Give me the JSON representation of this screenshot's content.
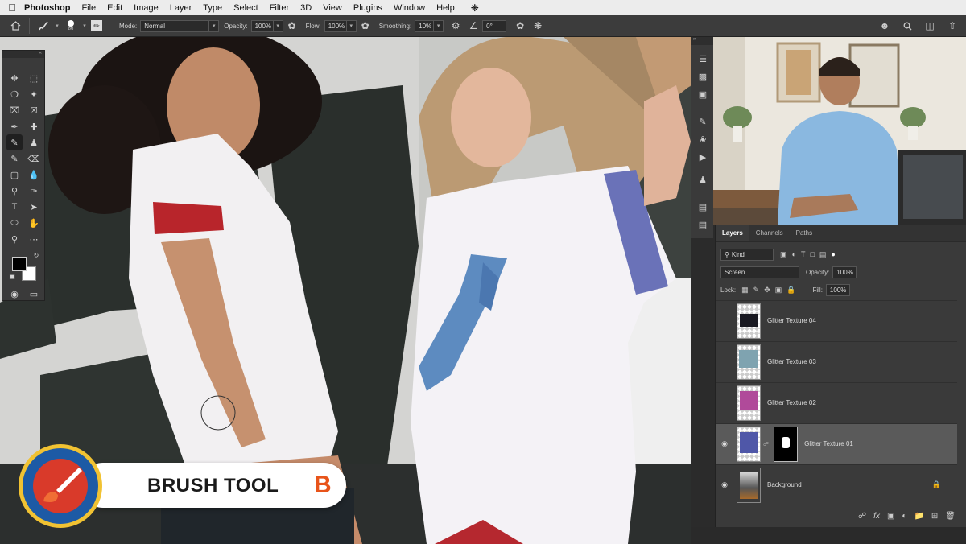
{
  "menubar": {
    "apple_icon": "apple-logo",
    "app_name": "Photoshop",
    "items": [
      "File",
      "Edit",
      "Image",
      "Layer",
      "Type",
      "Select",
      "Filter",
      "3D",
      "View",
      "Plugins",
      "Window",
      "Help"
    ]
  },
  "options_bar": {
    "brush_size": "86",
    "mode_label": "Mode:",
    "mode_value": "Normal",
    "opacity_label": "Opacity:",
    "opacity_value": "100%",
    "flow_label": "Flow:",
    "flow_value": "100%",
    "smoothing_label": "Smoothing:",
    "smoothing_value": "10%",
    "angle_value": "0°"
  },
  "layers_panel": {
    "tabs": [
      "Layers",
      "Channels",
      "Paths"
    ],
    "active_tab": "Layers",
    "filter_kind": "Kind",
    "blend_mode": "Screen",
    "opacity_label": "Opacity:",
    "opacity_value": "100%",
    "lock_label": "Lock:",
    "fill_label": "Fill:",
    "fill_value": "100%",
    "layers": [
      {
        "name": "Glitter Texture 04",
        "visible": false,
        "selected": false
      },
      {
        "name": "Glitter Texture 03",
        "visible": false,
        "selected": false
      },
      {
        "name": "Glitter Texture 02",
        "visible": false,
        "selected": false
      },
      {
        "name": "Glitter Texture 01",
        "visible": true,
        "selected": true
      },
      {
        "name": "Background",
        "visible": true,
        "selected": false
      }
    ]
  },
  "badge": {
    "title": "BRUSH TOOL",
    "shortcut": "B",
    "accent_color": "#e8541a"
  },
  "colors": {
    "foreground": "#000000",
    "background": "#ffffff"
  }
}
